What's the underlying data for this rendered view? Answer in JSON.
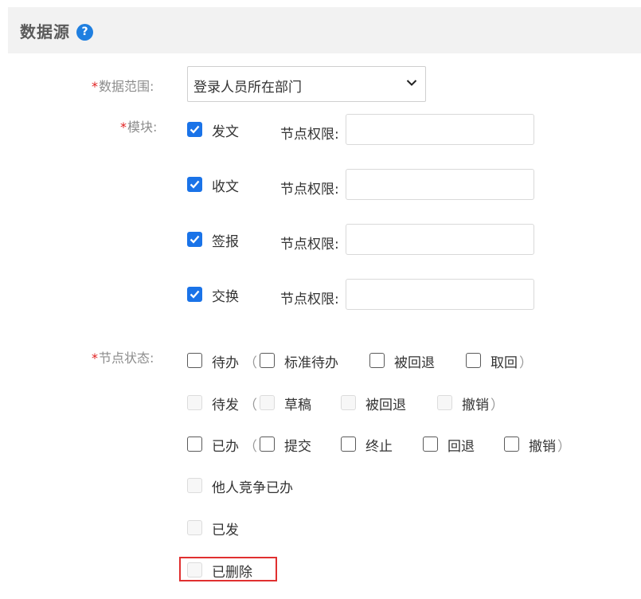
{
  "header": {
    "title": "数据源",
    "help_icon": "question-circle-icon"
  },
  "form": {
    "data_scope": {
      "required_mark": "*",
      "label": "数据范围:",
      "value": "登录人员所在部门"
    },
    "modules": {
      "required_mark": "*",
      "label": "模块:",
      "node_perm_label": "节点权限:",
      "items": [
        {
          "label": "发文",
          "checked": true,
          "node_perm_value": ""
        },
        {
          "label": "收文",
          "checked": true,
          "node_perm_value": ""
        },
        {
          "label": "签报",
          "checked": true,
          "node_perm_value": ""
        },
        {
          "label": "交换",
          "checked": true,
          "node_perm_value": ""
        }
      ]
    },
    "node_status": {
      "required_mark": "*",
      "label": "节点状态:",
      "open_paren": "（",
      "close_paren": "）",
      "rows": {
        "todo": {
          "label": "待办",
          "enabled": true,
          "subs": [
            "标准待办",
            "被回退",
            "取回"
          ]
        },
        "to_send": {
          "label": "待发",
          "enabled": false,
          "subs": [
            "草稿",
            "被回退",
            "撤销"
          ]
        },
        "done": {
          "label": "已办",
          "enabled": true,
          "subs": [
            "提交",
            "终止",
            "回退",
            "撤销"
          ]
        },
        "others_done": {
          "label": "他人竞争已办",
          "enabled": false
        },
        "sent": {
          "label": "已发",
          "enabled": false
        },
        "deleted": {
          "label": "已删除",
          "enabled": false,
          "highlighted": true
        }
      }
    }
  },
  "colors": {
    "accent": "#1a73e8",
    "required": "#e02020",
    "highlight": "#e03030"
  }
}
